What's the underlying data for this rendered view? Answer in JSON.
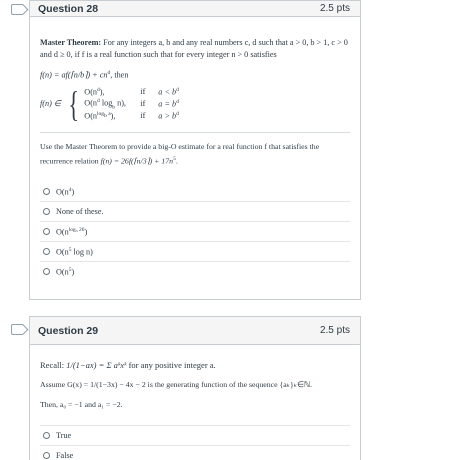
{
  "q28": {
    "title": "Question 28",
    "points": "2.5 pts",
    "theorem_intro": "Master Theorem:",
    "theorem_text": "For any integers a, b and any real numbers c, d such that a > 0, b > 1, c > 0 and d ≥ 0, if f is a real function such that for every integer n > 0 satisfies",
    "recurrence": "f(n) = af(⌈n/b⌉) + cn",
    "recurrence_exp": "d",
    "recurrence_tail": ", then",
    "f_prefix": "f(n) ∈",
    "cases": [
      {
        "expr": "O(n",
        "exp": "d",
        "close": "),",
        "if": "if",
        "cond": "a < b",
        "cond_exp": "d"
      },
      {
        "expr": "O(n",
        "exp": "d",
        "close": " log",
        "sub": "b",
        "tail": " n),",
        "if": "if",
        "cond": "a = b",
        "cond_exp": "d"
      },
      {
        "expr": "O(n",
        "exp": "log",
        "sub": "b",
        "exp2": " a",
        "close": "),",
        "if": "if",
        "cond": "a > b",
        "cond_exp": "d"
      }
    ],
    "question_text": "Use the Master Theorem to provide a big-O estimate for a real function f that satisfies the recurrence relation",
    "question_formula": "f(n) = 26f(⌈n/3⌉) + 17n",
    "question_exp": "5",
    "answers": [
      {
        "label": "O(n",
        "exp": "4",
        "close": ")"
      },
      {
        "label": "None of these."
      },
      {
        "label": "O(n",
        "exp": "log₃ 26",
        "close": ")"
      },
      {
        "label": "O(n",
        "exp": "5",
        "close": " log n)"
      },
      {
        "label": "O(n",
        "exp": "5",
        "close": ")"
      }
    ]
  },
  "q29": {
    "title": "Question 29",
    "points": "2.5 pts",
    "recall_label": "Recall:",
    "recall_formula": "1/(1−ax) = Σ aᵏxᵏ",
    "recall_tail": "for any positive integer a.",
    "assume_text": "Assume G(x) = 1/(1−3x) − 4x − 2 is the generating function of the sequence {aₖ}ₖ∈ℕ.",
    "then_text": "Then, a₀ = −1 and a₁ = −2.",
    "answers": [
      {
        "label": "True"
      },
      {
        "label": "False"
      }
    ]
  }
}
